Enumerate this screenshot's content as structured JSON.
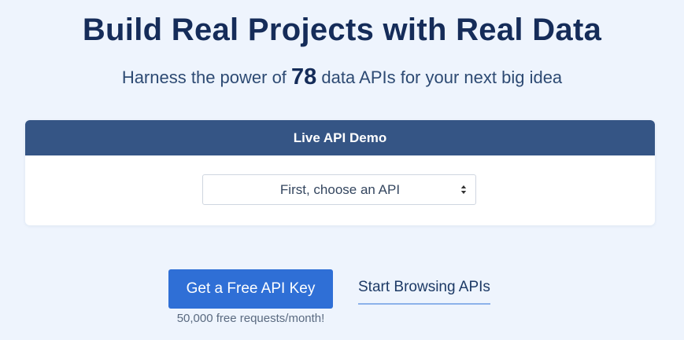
{
  "hero": {
    "title": "Build Real Projects with Real Data",
    "subtitle_prefix": "Harness the power of ",
    "api_count": "78",
    "subtitle_suffix": " data APIs for your next big idea"
  },
  "demo": {
    "header": "Live API Demo",
    "select": {
      "value": "First, choose an API",
      "icon": "select-arrows-icon"
    }
  },
  "cta": {
    "primary_label": "Get a Free API Key",
    "primary_note": "50,000 free requests/month!",
    "secondary_label": "Start Browsing APIs"
  },
  "colors": {
    "background": "#eef4fd",
    "title": "#152c59",
    "card_header": "#355585",
    "primary_button": "#2f6fd6",
    "link_underline": "#8cb2ea"
  }
}
